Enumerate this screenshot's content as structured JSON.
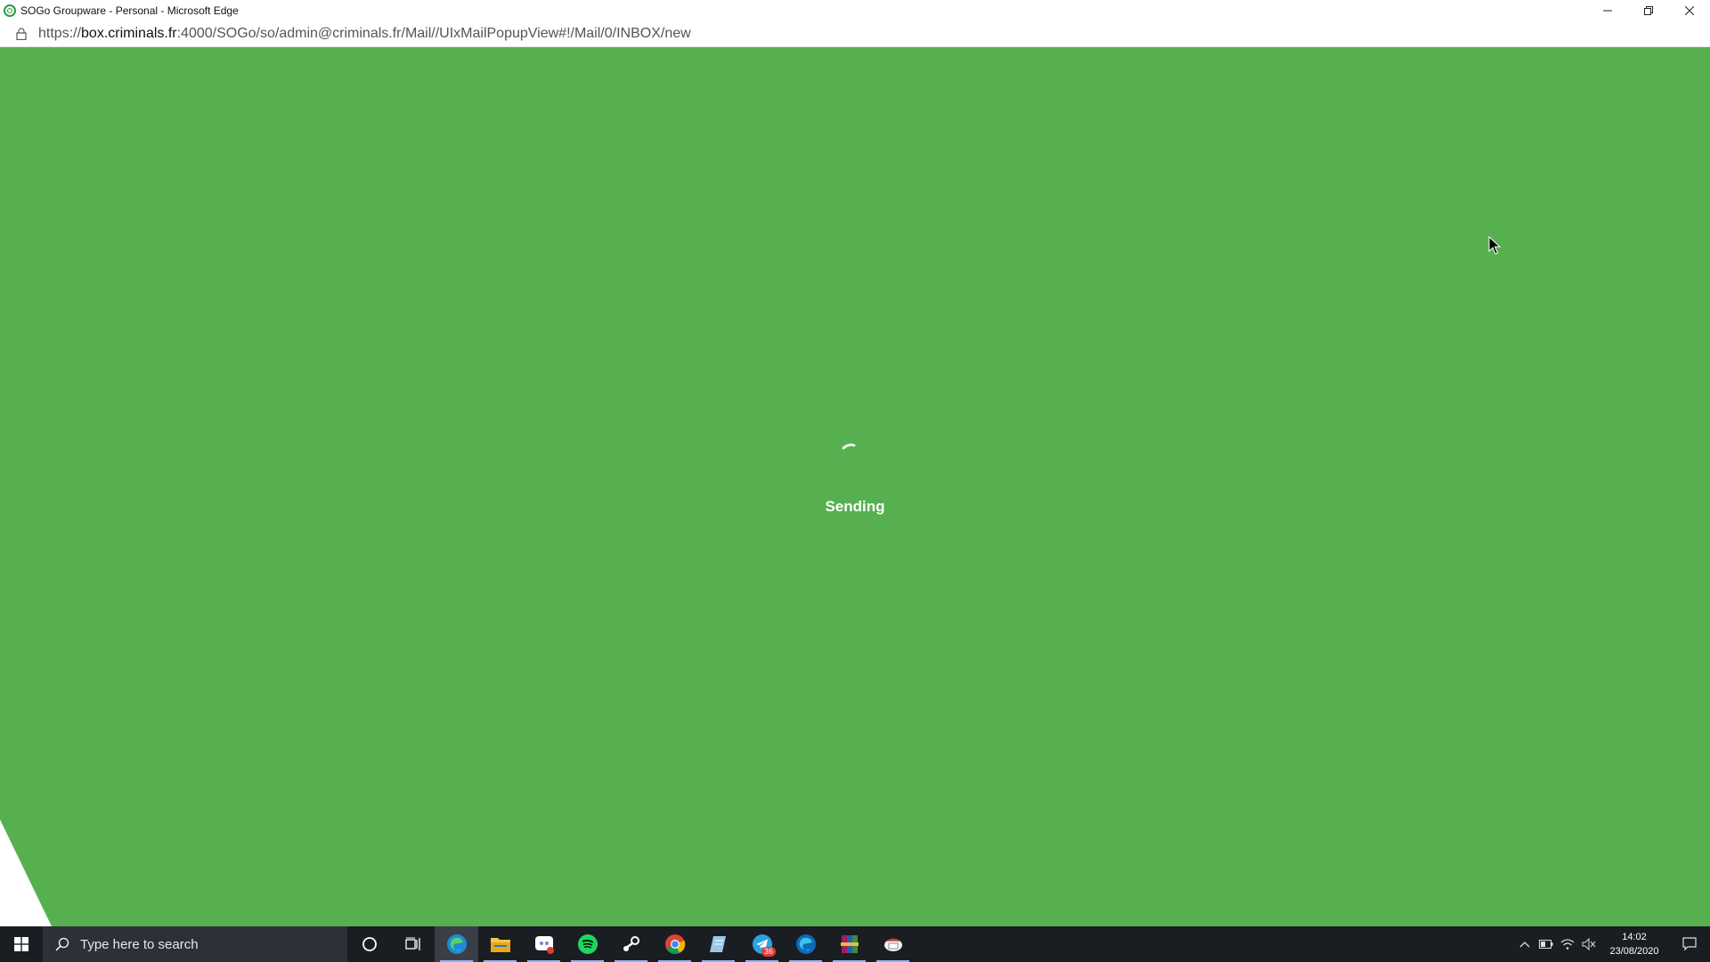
{
  "window": {
    "title": "SOGo Groupware - Personal - Microsoft Edge",
    "controls": [
      "minimize",
      "restore",
      "close"
    ]
  },
  "address_bar": {
    "url_scheme": "https://",
    "url_host": "box.criminals.fr",
    "url_rest": ":4000/SOGo/so/admin@criminals.fr/Mail//UIxMailPopupView#!/Mail/0/INBOX/new"
  },
  "content": {
    "status_text": "Sending",
    "background_color": "#56b04f"
  },
  "taskbar": {
    "search_placeholder": "Type here to search",
    "pinned_apps": [
      {
        "name": "cortana-icon"
      },
      {
        "name": "task-view-icon"
      },
      {
        "name": "edge-icon",
        "active": true
      },
      {
        "name": "file-explorer-icon"
      },
      {
        "name": "discord-icon"
      },
      {
        "name": "spotify-icon"
      },
      {
        "name": "steam-icon"
      },
      {
        "name": "chrome-icon"
      },
      {
        "name": "notes-icon"
      },
      {
        "name": "telegram-icon",
        "badge": "36"
      },
      {
        "name": "edge-dev-icon"
      },
      {
        "name": "winrar-icon"
      },
      {
        "name": "thunderbird-icon"
      }
    ],
    "clock_time": "14:02",
    "clock_date": "23/08/2020"
  }
}
